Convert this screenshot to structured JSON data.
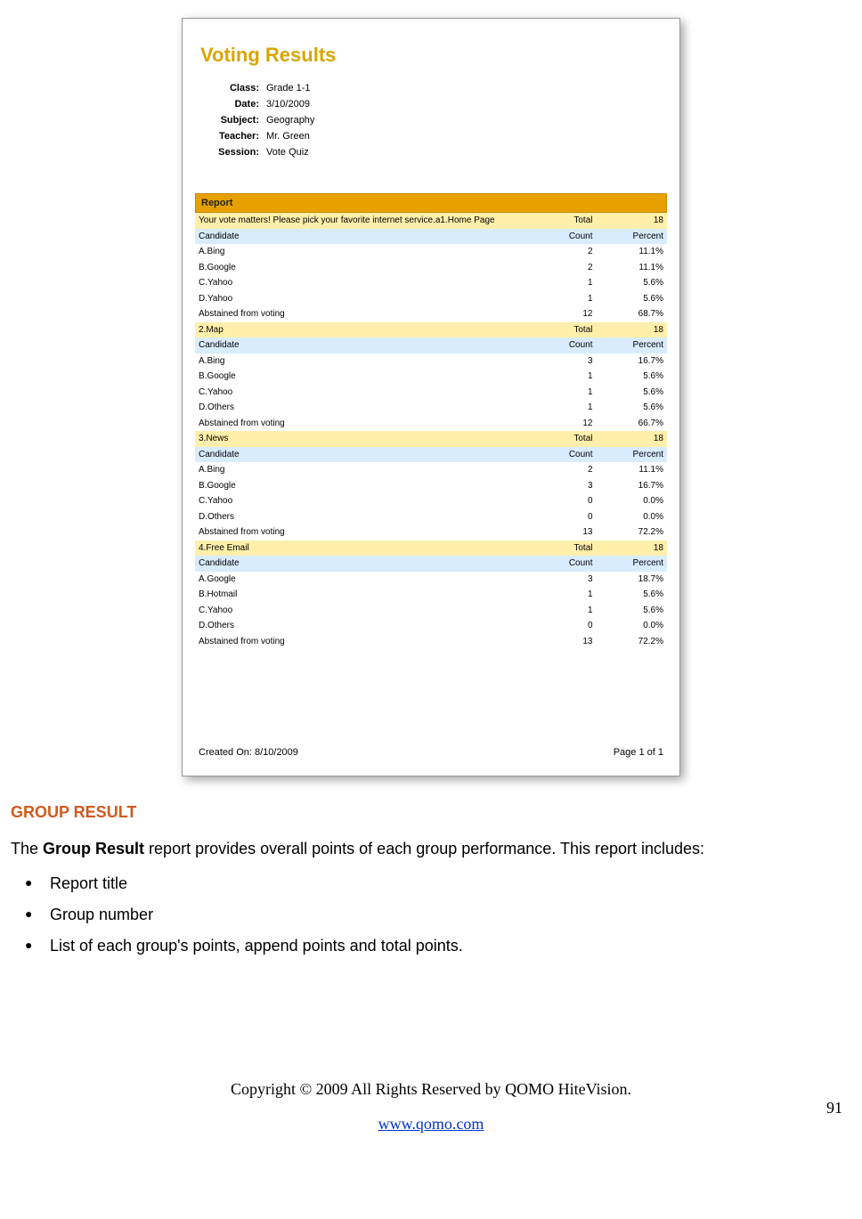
{
  "screenshot": {
    "title": "Voting Results",
    "meta": {
      "class_label": "Class:",
      "class_value": "Grade 1-1",
      "date_label": "Date:",
      "date_value": "3/10/2009",
      "subject_label": "Subject:",
      "subject_value": "Geography",
      "teacher_label": "Teacher:",
      "teacher_value": "Mr. Green",
      "session_label": "Session:",
      "session_value": "Vote Quiz"
    },
    "report_bar": "Report",
    "question_header_text": "Your vote matters! Please pick your favorite internet service.a1.Home Page",
    "total_label": "Total",
    "candidate_label": "Candidate",
    "count_label": "Count",
    "percent_label": "Percent",
    "sections": [
      {
        "q": "Your vote matters! Please pick your favorite internet service.a1.Home Page",
        "total": "18",
        "rows": [
          {
            "c": "A.Bing",
            "n": "2",
            "p": "11.1%"
          },
          {
            "c": "B.Google",
            "n": "2",
            "p": "11.1%"
          },
          {
            "c": "C.Yahoo",
            "n": "1",
            "p": "5.6%"
          },
          {
            "c": "D.Yahoo",
            "n": "1",
            "p": "5.6%"
          },
          {
            "c": "Abstained from voting",
            "n": "12",
            "p": "68.7%"
          }
        ]
      },
      {
        "q": "2.Map",
        "total": "18",
        "rows": [
          {
            "c": "A.Bing",
            "n": "3",
            "p": "16.7%"
          },
          {
            "c": "B.Google",
            "n": "1",
            "p": "5.6%"
          },
          {
            "c": "C.Yahoo",
            "n": "1",
            "p": "5.6%"
          },
          {
            "c": "D.Others",
            "n": "1",
            "p": "5.6%"
          },
          {
            "c": "Abstained from voting",
            "n": "12",
            "p": "66.7%"
          }
        ]
      },
      {
        "q": "3.News",
        "total": "18",
        "rows": [
          {
            "c": "A.Bing",
            "n": "2",
            "p": "11.1%"
          },
          {
            "c": "B.Google",
            "n": "3",
            "p": "16.7%"
          },
          {
            "c": "C.Yahoo",
            "n": "0",
            "p": "0.0%"
          },
          {
            "c": "D.Others",
            "n": "0",
            "p": "0.0%"
          },
          {
            "c": "Abstained from voting",
            "n": "13",
            "p": "72.2%"
          }
        ]
      },
      {
        "q": "4.Free Email",
        "total": "18",
        "rows": [
          {
            "c": "A.Google",
            "n": "3",
            "p": "18.7%"
          },
          {
            "c": "B.Hotmail",
            "n": "1",
            "p": "5.6%"
          },
          {
            "c": "C.Yahoo",
            "n": "1",
            "p": "5.6%"
          },
          {
            "c": "D.Others",
            "n": "0",
            "p": "0.0%"
          },
          {
            "c": "Abstained from voting",
            "n": "13",
            "p": "72.2%"
          }
        ]
      }
    ],
    "footer_left": "Created On: 8/10/2009",
    "footer_right": "Page 1 of 1"
  },
  "doc": {
    "heading": "GROUP RESULT",
    "intro_pre": "The ",
    "intro_bold": "Group Result",
    "intro_post": " report provides overall points of each group performance. This report includes:",
    "bullets": [
      "Report title",
      "Group number",
      "List of each group's points, append points and total points."
    ],
    "copyright": "Copyright © 2009 All Rights Reserved by QOMO HiteVision.",
    "url": "www.qomo.com",
    "page_num": "91"
  }
}
